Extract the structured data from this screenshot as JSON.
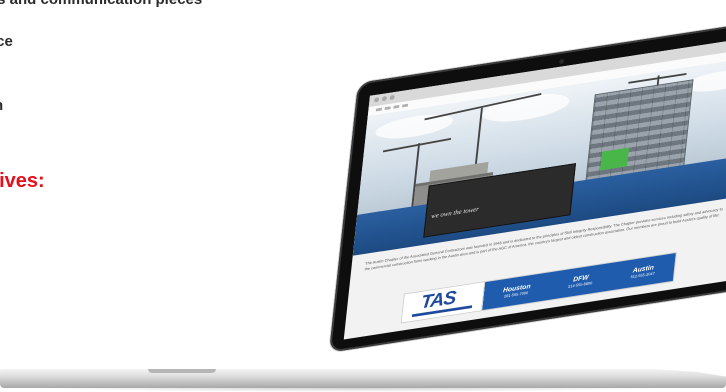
{
  "left_text": {
    "line1": "ns and communication pieces",
    "line2": "ice",
    "line3": "n",
    "heading": "eives:"
  },
  "site": {
    "hero_banner": "we own the tower",
    "about_text": "The Austin Chapter of the Associated General Contractors was founded in 1948 and is dedicated to the principles of Skill Integrity Responsibility. The Chapter provides services including safety and advocacy to the commercial construction firms working in the Austin area and is part of the AGC of America, the country's largest and oldest construction association. Our members are proud to build Austin's quality of life!",
    "ad": {
      "brand": "TAS",
      "cities": [
        {
          "name": "Houston",
          "phone": "281-555-7000"
        },
        {
          "name": "DFW",
          "phone": "214-555-8800"
        },
        {
          "name": "Austin",
          "phone": "512-555-2047"
        }
      ],
      "url": "www.tasinc.com"
    }
  },
  "colors": {
    "heading_red": "#e3101d",
    "fence_blue": "#1d4a82",
    "ad_blue": "#1f5cad"
  }
}
